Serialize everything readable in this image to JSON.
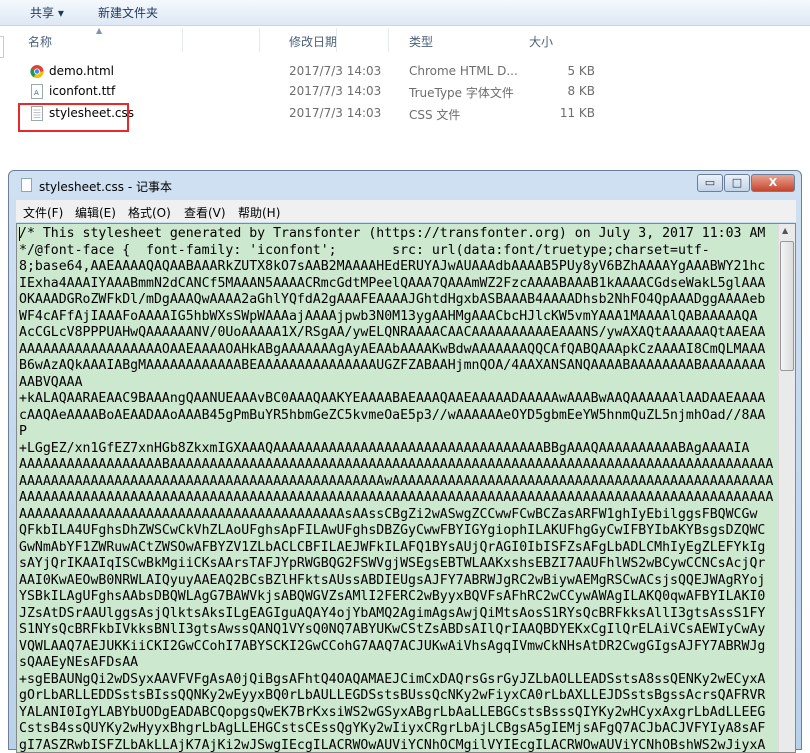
{
  "explorer": {
    "toolbar": {
      "share": "共享 ▾",
      "new_folder": "新建文件夹"
    },
    "columns": {
      "name": "名称",
      "modified": "修改日期",
      "type": "类型",
      "size": "大小"
    },
    "files": [
      {
        "name": "demo.html",
        "modified": "2017/7/3 14:03",
        "type": "Chrome HTML D...",
        "size": "5 KB",
        "icon": "chrome-icon"
      },
      {
        "name": "iconfont.ttf",
        "modified": "2017/7/3 14:03",
        "type": "TrueType 字体文件",
        "size": "8 KB",
        "icon": "font-file-icon"
      },
      {
        "name": "stylesheet.css",
        "modified": "2017/7/3 14:03",
        "type": "CSS 文件",
        "size": "11 KB",
        "icon": "text-file-icon",
        "highlighted": true
      }
    ],
    "highlight_color": "#e8282b"
  },
  "notepad": {
    "title": "stylesheet.css - 记事本",
    "buttons": {
      "minimize": "▭",
      "maximize": "□",
      "close": "X"
    },
    "menu": [
      "文件(F)",
      "编辑(E)",
      "格式(O)",
      "查看(V)",
      "帮助(H)"
    ],
    "background": "#cce8cf",
    "lines": [
      "/* This stylesheet generated by Transfonter (https://transfonter.org) on July 3, 2017 11:03 AM",
      "*/@font-face {  font-family: 'iconfont';       src: url(data:font/truetype;charset=utf-",
      "8;base64,AAEAAAAQAQAABAAARkZUTX8kO7sAAB2MAAAAHEdERUYAJwAUAAAdbAAAAB5PUy8yV6BZhAAAAYgAAABWY21hc",
      "IExha4AAAIYAAABmmN2dCANCf5MAAAN5AAAACRmcGdtMPeelQAAA7QAAAmWZ2FzcAAAABAAAB1kAAAACGdseWakL5glAAA",
      "OKAAADGRoZWFkDl/mDgAAAQwAAAA2aGhlYQfdA2gAAAFEAAAAJGhtdHgxbASBAAAB4AAAADhsb2NhFO4QpAAADggAAAAeb",
      "WF4cAFfAjIAAAFoAAAAIG5hbWXsSWpWAAAajAAAAjpwb3N0M13ygAAHMgAAACbcHJlcKW5vmYAAA1MAAAAlQABAAAAAQA",
      "AcCGLcV8PPPUAHwQAAAAAANV/0UoAAAAA1X/RSgAA/ywELQNRAAAACAACAAAAAAAAAAEAAANS/ywAXAQtAAAAAAQtAAEAA",
      "AAAAAAAAAAAAAAAAAAOAAEAAAAOAHkABgAAAAAAAgAyAEAAbAAAAKwBdwAAAAAAAQQCAfQABQAAApkCzAAAAI8CmQLMAAA",
      "B6wAzAQkAAAIABgMAAAAAAAAAAAABEAAAAAAAAAAAAAAAUGZFZABAAHjmnQOA/4AAXANSANQAAAABAAAAAAAABAAAAAAAA",
      "AABVQAAA",
      "+kALAQAARAEAAC9BAAAngQAANUEAAAvBC0AAAQAAKYEAAAABAEAAAQAAEAAAAADAAAAAwAAABwAAQAAAAAAlAADAAEAAAA",
      "cAAQAeAAAABoAEAADAAoAAAB45gPmBuYR5hbmGeZC5kvmeOaE5p3//wAAAAAAeOYD5gbmEeYW5hnmQuZL5njmhOad//8AA",
      "P",
      "+LGgEZ/xn1GfEZ7xnHGb8ZkxmIGXAAAQAAAAAAAAAAAAAAAAAAAAAAAAAAAAAAAAAABBgAAAQAAAAAAAAAABAgAAAAIA",
      "AAAAAAAAAAAAAAAAAABAAAAAAAAAAAAAAAAAAAAAAAAAAAAAAAAAAAAAAAAAAAAAAAAAAAAAAAAAAAAAAAAAAAAAAAAAAAA",
      "AAAAAAAAAAAAAAAAAAAAAAAAAAAAAAAAAAAAAAAAAAAAAAwAAAAAAAAAAAAAAAAAAAAAAAAAAAAAAAAAAAAAAAAAAAAAAAA",
      "AAAAAAAAAAAAAAAAAAAAAAAAAAAAAAAAAAAAAAAAAAAAAAAAAAAAAAAAAAAAAAAAAAAAAAAAAAAAAAAAAAAAAAAAAAAAAAA",
      "AAAAAAAAAAAAAAAAAAAAAAAAAAAAAAAAAAAAAAAAAsAAssCBgZi2wASwgZCCwwFCwBCZasARFW1ghIyEbilggsFBQWCGw",
      "QFkbILA4UFghsDhZWSCwCkVhZLAoUFghsApFILAwUFghsDBZGyCwwFBYIGYgiophILAKUFhgGyCwIFBYIbAKYBsgsDZQWC",
      "GwNmAbYF1ZWRuwACtZWSOwAFBYZV1ZLbACLCBFILAEJWFkILAFQ1BYsAUjQrAGI0IbISFZsAFgLbADLCMhIyEgZLEFYkIg",
      "sAYjQrIKAAIqISCwBkMgiiCKsAArsTAFJYpRWGBQG2FSWVgjWSEgsEBTWLAAKxshsEBZI7AAUFhlWS2wBCywCCNCsAcjQr",
      "AAI0KwAEOwB0NRWLAIQyuyAAEAQ2BCsBZlHFktsAUssABDIEUgsAJFY7ABRWJgRC2wBiywAEMgRSCwACsjsQQEJWAgRYoj",
      "YSBkILAgUFghsAAbsDBQWLAgG7BAWVkjsABQWGVZsAMlI2FERC2wByyxBQVFsAFhRC2wCCywAWAgILAKQ0qwAFBYILAKI0",
      "JZsAtDSrAAUlggsAsjQlktsAksILgEAGIguAQAY4ojYbAMQ2AgimAgsAwjQiMtsAosS1RYsQcBRFkksAllI3gtsAssS1FY",
      "S1NYsQcBRFkbIVkksBNlI3gtsAwssQANQ1VYsQ0NQ7ABYUKwCStZsABDsAIlQrIAAQBDYEKxCgIlQrELAiVCsAEWIyCwAy",
      "VQWLAAQ7AEJUKKiiCKI2GwCCohI7ABYSCKI2GwCCohG7AAQ7ACJUKwAiVhsAgqIVmwCkNHsAtDR2CwgGIgsAJFY7ABRWJg",
      "sQAAEyNEsAFDsAA",
      "+sgEBAUNgQi2wDSyxAAVFVFgAsA0jQiBgsAFhtQ4OAQAMAEJCimCxDAQrsGsrGyJZLbAOLLEADSstsA8ssQENKy2wECyxA",
      "gOrLbARLLEDDSstsBIssQQNKy2wEyyxBQ0rLbAULLEGDSstsBUssQcNKy2wFiyxCA0rLbAXLLEJDSstsBgssAcrsQAFRVR",
      "YALANI0IgYLABYbUODgEADABCQopgsQwEK7BrKxsiWS2wGSyxABgrLbAaLLEBGCstsBsssQIYKy2wHCyxAxgrLbAdLLEEG",
      "CstsB4ssQUYKy2wHyyxBhgrLbAgLLEHGCstsCEssQgYKy2wIiyxCRgrLbAjLCBgsA5gIEMjsAFgQ7ACJbACJVFYIyA8sAF",
      "gI7ASZRwbISFZLbAkLLAjK7AjKi2wJSwgIEcgILACRWOwAUViYCNhOCMgilVYIEcgILACRWOwAUViYCNhOBshWS2wJiyxA"
    ]
  }
}
